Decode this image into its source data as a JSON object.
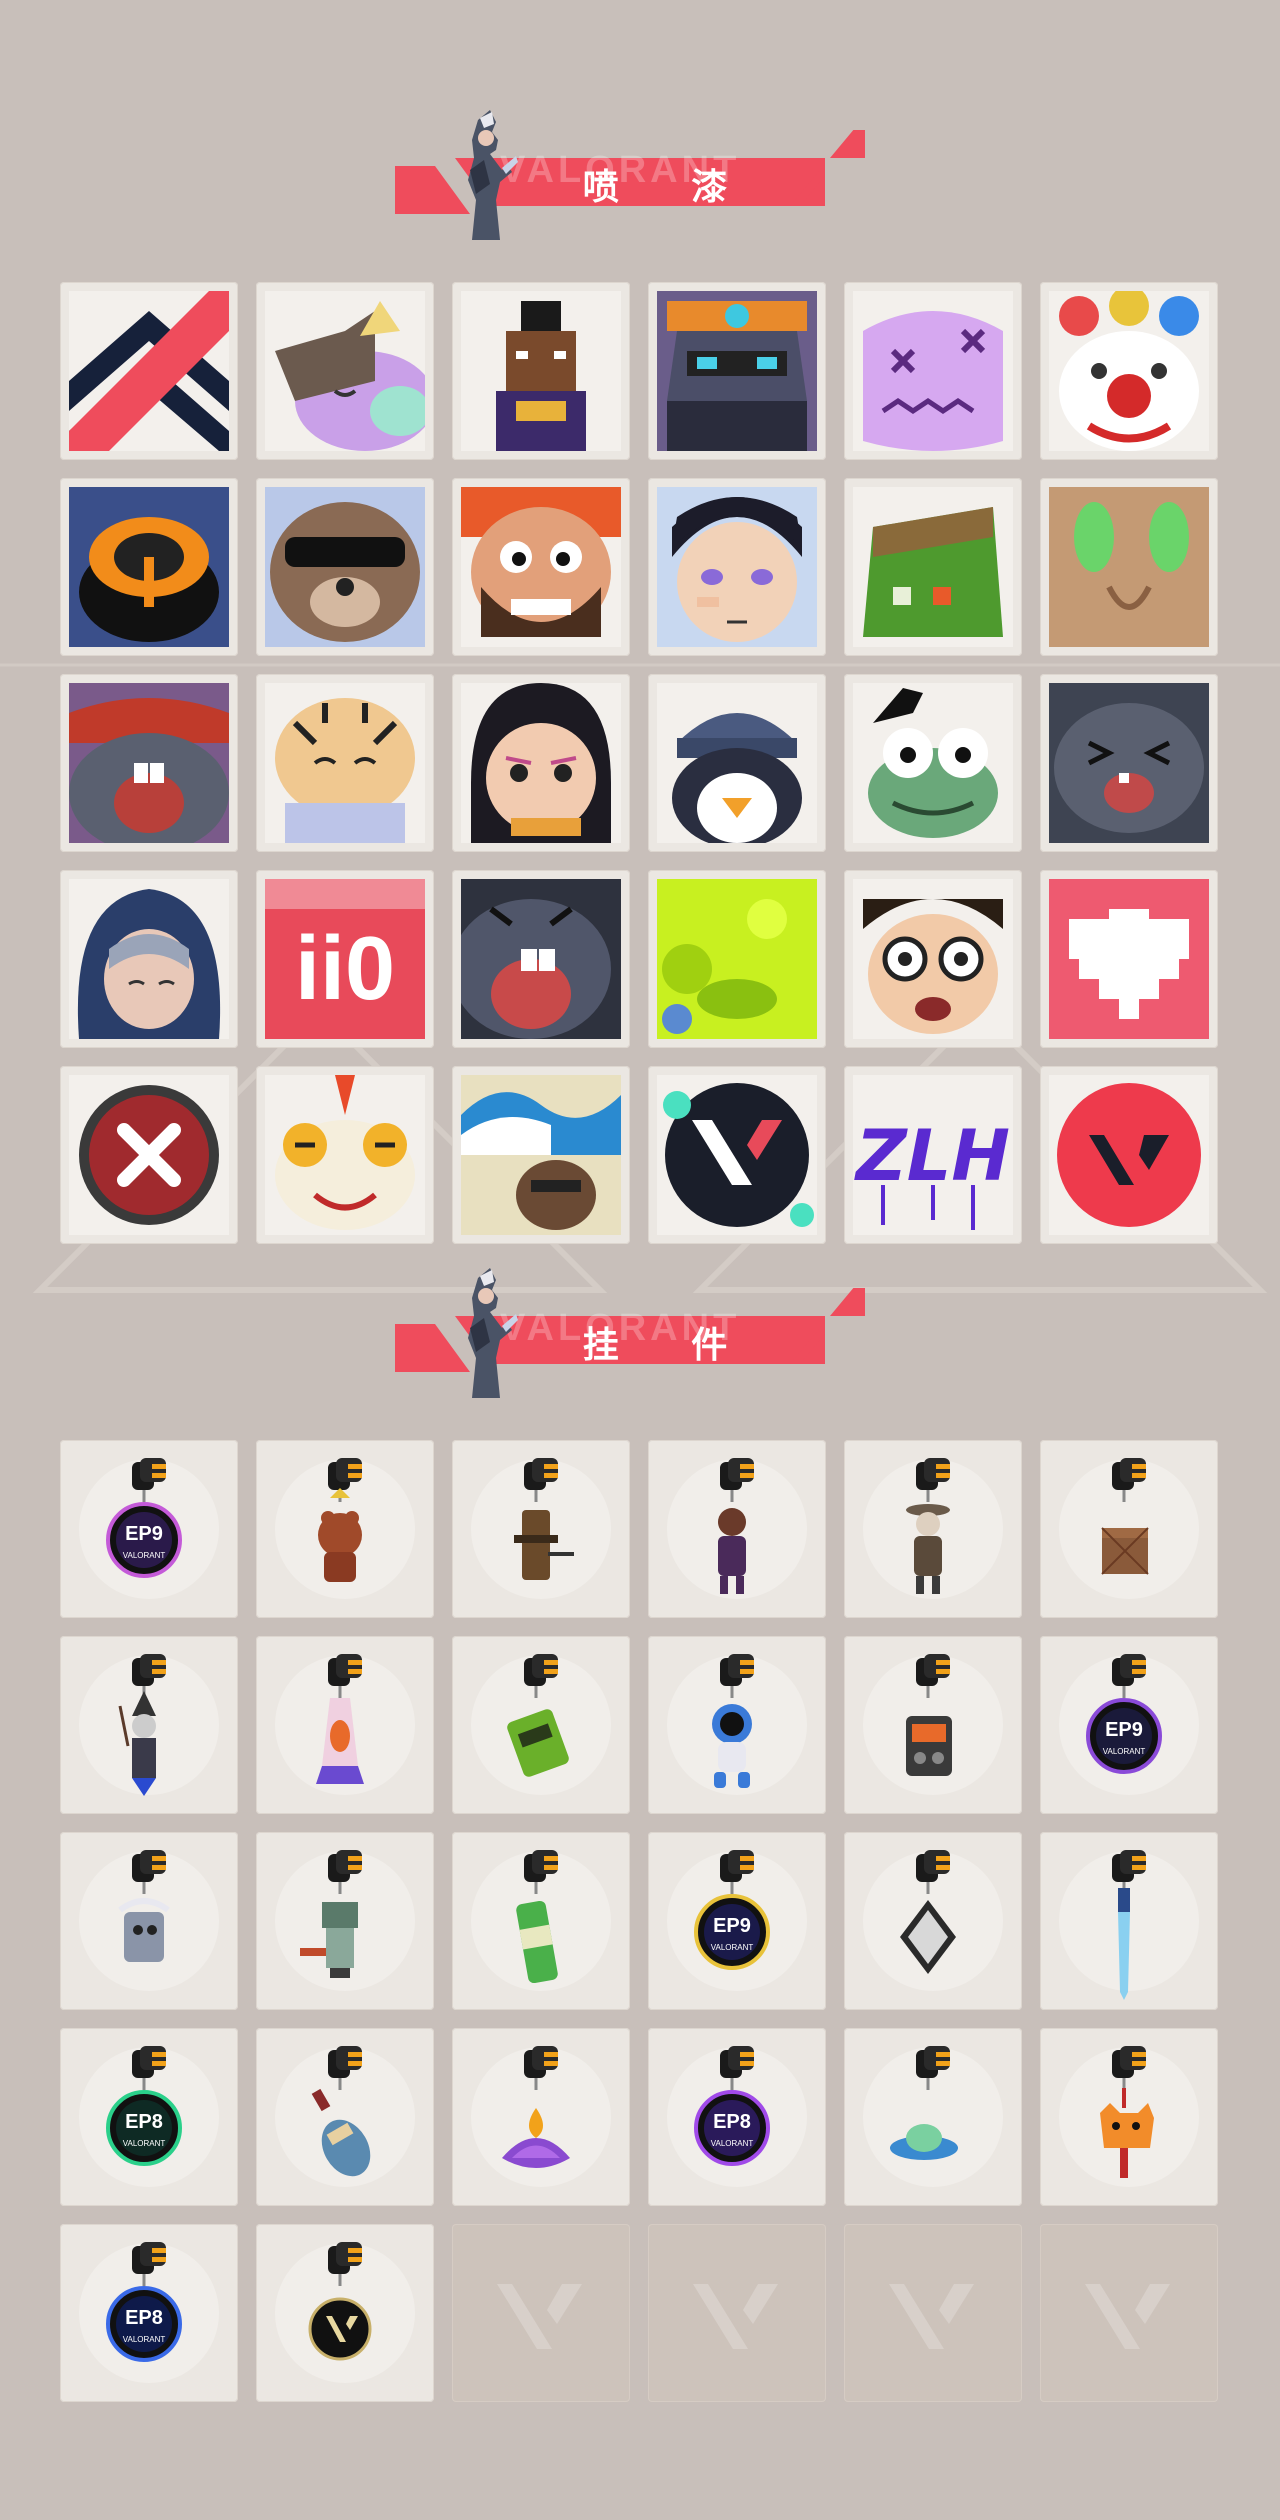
{
  "colors": {
    "background": "#c8bfba",
    "accent": "#ef4c5c",
    "tile": "#ebe7e2",
    "empty_tile": "#cdc3bb"
  },
  "sections": {
    "sprays": {
      "title": "喷 漆",
      "watermark": "VALORANT",
      "rows": 5,
      "cols": 6
    },
    "buddies": {
      "title": "挂 件",
      "watermark": "VALORANT",
      "rows": 5,
      "cols": 6
    }
  },
  "sprays": [
    {
      "icon": "chevron-stripes-icon"
    },
    {
      "icon": "sleepy-creature-icon"
    },
    {
      "icon": "pixel-agent-icon"
    },
    {
      "icon": "robot-helmet-icon"
    },
    {
      "icon": "purple-blob-face-icon"
    },
    {
      "icon": "clown-face-icon"
    },
    {
      "icon": "orange-gadget-icon"
    },
    {
      "icon": "sunglasses-bear-icon"
    },
    {
      "icon": "bearded-agent-icon"
    },
    {
      "icon": "boy-face-icon"
    },
    {
      "icon": "green-box-icon"
    },
    {
      "icon": "green-eyes-creature-icon"
    },
    {
      "icon": "crying-creature-icon"
    },
    {
      "icon": "tiger-icon"
    },
    {
      "icon": "girl-drawing-icon"
    },
    {
      "icon": "penguin-beanie-icon"
    },
    {
      "icon": "frog-icon"
    },
    {
      "icon": "laughing-creature-icon"
    },
    {
      "icon": "hooded-agent-icon"
    },
    {
      "icon": "ii0-text-icon",
      "text": "ii0"
    },
    {
      "icon": "screaming-creature-icon"
    },
    {
      "icon": "lime-slime-icon"
    },
    {
      "icon": "glasses-guy-icon"
    },
    {
      "icon": "pixel-heart-icon"
    },
    {
      "icon": "x-button-icon"
    },
    {
      "icon": "dragon-dancer-icon"
    },
    {
      "icon": "wave-bear-icon"
    },
    {
      "icon": "valorant-logo-splat-icon"
    },
    {
      "icon": "graffiti-tag-icon"
    },
    {
      "icon": "red-valorant-circle-icon"
    }
  ],
  "buddies": [
    {
      "icon": "ep9-medal-pink-icon",
      "text": "EP9"
    },
    {
      "icon": "bear-bell-icon"
    },
    {
      "icon": "holster-icon"
    },
    {
      "icon": "agent-figure-icon"
    },
    {
      "icon": "cowboy-figure-icon"
    },
    {
      "icon": "crate-icon"
    },
    {
      "icon": "wizard-figure-icon"
    },
    {
      "icon": "lava-lamp-icon"
    },
    {
      "icon": "green-device-icon"
    },
    {
      "icon": "astronaut-icon"
    },
    {
      "icon": "radio-icon"
    },
    {
      "icon": "ep9-medal-purple-icon",
      "text": "EP9"
    },
    {
      "icon": "agent-cube-icon"
    },
    {
      "icon": "robot-arm-icon"
    },
    {
      "icon": "soda-can-icon"
    },
    {
      "icon": "ep9-medal-yellow-icon",
      "text": "EP9"
    },
    {
      "icon": "diamond-tag-icon"
    },
    {
      "icon": "crystal-sword-icon"
    },
    {
      "icon": "ep8-medal-green-icon",
      "text": "EP8"
    },
    {
      "icon": "potion-bottle-icon"
    },
    {
      "icon": "lotus-flame-icon"
    },
    {
      "icon": "ep8-medal-purple-icon",
      "text": "EP8"
    },
    {
      "icon": "ufo-icon"
    },
    {
      "icon": "tiger-plush-icon"
    },
    {
      "icon": "ep8-medal-blue-icon",
      "text": "EP8"
    },
    {
      "icon": "valorant-medal-icon"
    },
    {
      "icon": "empty-slot-icon",
      "empty": true
    },
    {
      "icon": "empty-slot-icon",
      "empty": true
    },
    {
      "icon": "empty-slot-icon",
      "empty": true
    },
    {
      "icon": "empty-slot-icon",
      "empty": true
    }
  ]
}
